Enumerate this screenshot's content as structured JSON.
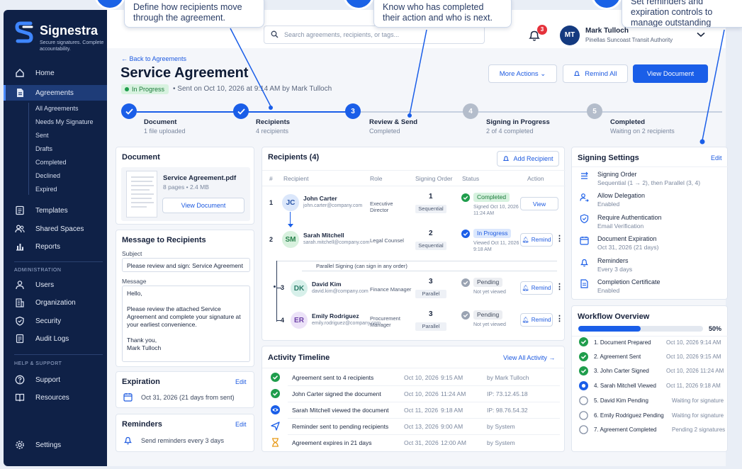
{
  "callouts": [
    {
      "text": "Define how recipients move through the agreement."
    },
    {
      "text": "Know who has completed their action and who is next."
    },
    {
      "text": "Set reminders and expiration controls to manage outstanding actions."
    }
  ],
  "sidebar": {
    "brand": "Signestra",
    "tagline": "Secure signatures. Complete accountability.",
    "nav": [
      {
        "label": "Home"
      },
      {
        "label": "Agreements"
      },
      {
        "label": "Templates"
      },
      {
        "label": "Shared Spaces"
      },
      {
        "label": "Reports"
      }
    ],
    "sub_items": [
      "All Agreements",
      "Needs My Signature",
      "Sent",
      "Drafts",
      "Completed",
      "Declined",
      "Expired"
    ],
    "admin_heading": "ADMINISTRATION",
    "admin_items": [
      {
        "label": "Users"
      },
      {
        "label": "Organization"
      },
      {
        "label": "Security"
      },
      {
        "label": "Audit Logs"
      }
    ],
    "help_heading": "HELP & SUPPORT",
    "help_items": [
      {
        "label": "Support"
      },
      {
        "label": "Resources"
      }
    ],
    "settings_label": "Settings"
  },
  "topbar": {
    "search_placeholder": "Search agreements, recipients, or tags...",
    "notification_count": "3",
    "user_initials": "MT",
    "user_name": "Mark Tulloch",
    "user_org": "Pinellas Suncoast Transit Authority"
  },
  "header": {
    "back_label": "Back to Agreements",
    "title": "Service Agreement",
    "status": "In Progress",
    "sent_info": "Sent on Oct 10, 2026 at 9:14 AM by Mark Tulloch",
    "more_actions": "More Actions",
    "remind_all": "Remind All",
    "view_document": "View Document"
  },
  "steps": [
    {
      "num": "",
      "title": "Document",
      "sub": "1 file uploaded",
      "state": "done"
    },
    {
      "num": "",
      "title": "Recipients",
      "sub": "4 recipients",
      "state": "done"
    },
    {
      "num": "3",
      "title": "Review & Send",
      "sub": "Completed",
      "state": "current"
    },
    {
      "num": "4",
      "title": "Signing in Progress",
      "sub": "2 of 4 completed",
      "state": "todo"
    },
    {
      "num": "5",
      "title": "Completed",
      "sub": "Waiting on 2 recipients",
      "state": "todo"
    }
  ],
  "document": {
    "title": "Document",
    "file_name": "Service Agreement.pdf",
    "file_meta": "8 pages • 2.4 MB",
    "view_label": "View Document"
  },
  "message": {
    "title": "Message to Recipients",
    "subject_label": "Subject",
    "subject_value": "Please review and sign: Service Agreement",
    "message_label": "Message",
    "body_hello": "Hello,",
    "body_main": "Please review the attached Service Agreement and complete your signature at your earliest convenience.",
    "body_thanks": "Thank you,",
    "body_name": "Mark Tulloch"
  },
  "expiration": {
    "title": "Expiration",
    "edit": "Edit",
    "value": "Oct 31, 2026 (21 days from sent)"
  },
  "reminders": {
    "title": "Reminders",
    "edit": "Edit",
    "value": "Send reminders every 3 days"
  },
  "recipients": {
    "title": "Recipients (4)",
    "add_label": "Add Recipient",
    "columns": [
      "#",
      "Recipient",
      "Role",
      "Signing Order",
      "Status",
      "Action"
    ],
    "parallel_note": "Parallel Signing (can sign in any order)",
    "rows": [
      {
        "num": "1",
        "initials": "JC",
        "name": "John Carter",
        "email": "john.carter@company.com",
        "role": "Executive Director",
        "order": "1",
        "order_type": "Sequential",
        "status": "Completed",
        "status_detail": "Signed Oct 10, 2026",
        "status_time": "11:24 AM",
        "action": "View",
        "avatar_bg": "#dbe7fb",
        "avatar_fg": "#2b56a8"
      },
      {
        "num": "2",
        "initials": "SM",
        "name": "Sarah Mitchell",
        "email": "sarah.mitchell@company.com",
        "role": "Legal Counsel",
        "order": "2",
        "order_type": "Sequential",
        "status": "In Progress",
        "status_detail": "Viewed Oct 11, 2026",
        "status_time": "9:18 AM",
        "action": "Remind",
        "avatar_bg": "#d8f1de",
        "avatar_fg": "#26804a"
      },
      {
        "num": "3",
        "initials": "DK",
        "name": "David Kim",
        "email": "david.kim@company.com",
        "role": "Finance Manager",
        "order": "3",
        "order_type": "Parallel",
        "status": "Pending",
        "status_detail": "Not yet viewed",
        "status_time": "",
        "action": "Remind",
        "avatar_bg": "#d7f0ea",
        "avatar_fg": "#2a7c68"
      },
      {
        "num": "4",
        "initials": "ER",
        "name": "Emily Rodriguez",
        "email": "emily.rodriguez@company.com",
        "role": "Procurement Manager",
        "order": "3",
        "order_type": "Parallel",
        "status": "Pending",
        "status_detail": "Not yet viewed",
        "status_time": "",
        "action": "Remind",
        "avatar_bg": "#ece2f8",
        "avatar_fg": "#6b3fa6"
      }
    ]
  },
  "activity": {
    "title": "Activity Timeline",
    "view_all": "View All Activity",
    "items": [
      {
        "text": "Agreement sent to 4 recipients",
        "date": "Oct 10, 2026",
        "time": "9:15 AM",
        "meta": "by Mark Tulloch",
        "icon": "check-circle-icon"
      },
      {
        "text": "John Carter signed the document",
        "date": "Oct 10, 2026",
        "time": "11:24 AM",
        "meta": "IP: 73.12.45.18",
        "icon": "check-circle-icon"
      },
      {
        "text": "Sarah Mitchell viewed the document",
        "date": "Oct 11, 2026",
        "time": "9:18 AM",
        "meta": "IP: 98.76.54.32",
        "icon": "eye-icon"
      },
      {
        "text": "Reminder sent to pending recipients",
        "date": "Oct 13, 2026",
        "time": "9:00 AM",
        "meta": "by System",
        "icon": "send-icon"
      },
      {
        "text": "Agreement expires in 21 days",
        "date": "Oct 31, 2026",
        "time": "12:00 AM",
        "meta": "by System",
        "icon": "hourglass-icon"
      }
    ]
  },
  "signing_settings": {
    "title": "Signing Settings",
    "edit": "Edit",
    "items": [
      {
        "label": "Signing Order",
        "value": "Sequential (1 → 2), then Parallel (3, 4)",
        "icon": "order-icon"
      },
      {
        "label": "Allow Delegation",
        "value": "Enabled",
        "icon": "delegate-icon"
      },
      {
        "label": "Require Authentication",
        "value": "Email Verification",
        "icon": "shield-icon"
      },
      {
        "label": "Document Expiration",
        "value": "Oct 31, 2026 (21 days)",
        "icon": "calendar-icon"
      },
      {
        "label": "Reminders",
        "value": "Every 3 days",
        "icon": "bell-icon"
      },
      {
        "label": "Completion Certificate",
        "value": "Enabled",
        "icon": "certificate-icon"
      }
    ]
  },
  "workflow": {
    "title": "Workflow Overview",
    "progress": 0.5,
    "progress_label": "50%",
    "items": [
      {
        "label": "1. Document Prepared",
        "meta": "Oct 10, 2026 9:14 AM",
        "state": "done"
      },
      {
        "label": "2. Agreement Sent",
        "meta": "Oct 10, 2026 9:15 AM",
        "state": "done"
      },
      {
        "label": "3. John Carter Signed",
        "meta": "Oct 10, 2026 11:24 AM",
        "state": "done"
      },
      {
        "label": "4. Sarah Mitchell Viewed",
        "meta": "Oct 11, 2026 9:18 AM",
        "state": "current"
      },
      {
        "label": "5. David Kim Pending",
        "meta": "Waiting for signature",
        "state": "todo"
      },
      {
        "label": "6. Emily Rodriguez Pending",
        "meta": "Waiting for signature",
        "state": "todo"
      },
      {
        "label": "7. Agreement Completed",
        "meta": "Pending 2 signatures",
        "state": "todo"
      }
    ]
  },
  "colors": {
    "primary": "#1a5ee8",
    "sidebar": "#0f2147",
    "success": "#1f9d4c"
  }
}
